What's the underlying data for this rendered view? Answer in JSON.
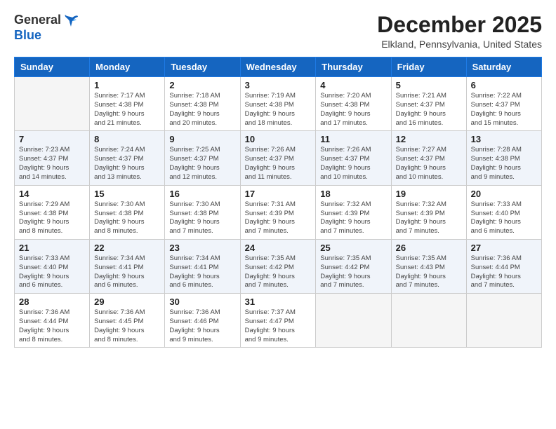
{
  "header": {
    "logo_general": "General",
    "logo_blue": "Blue",
    "month_title": "December 2025",
    "location": "Elkland, Pennsylvania, United States"
  },
  "days_of_week": [
    "Sunday",
    "Monday",
    "Tuesday",
    "Wednesday",
    "Thursday",
    "Friday",
    "Saturday"
  ],
  "weeks": [
    [
      {
        "day": "",
        "info": ""
      },
      {
        "day": "1",
        "info": "Sunrise: 7:17 AM\nSunset: 4:38 PM\nDaylight: 9 hours\nand 21 minutes."
      },
      {
        "day": "2",
        "info": "Sunrise: 7:18 AM\nSunset: 4:38 PM\nDaylight: 9 hours\nand 20 minutes."
      },
      {
        "day": "3",
        "info": "Sunrise: 7:19 AM\nSunset: 4:38 PM\nDaylight: 9 hours\nand 18 minutes."
      },
      {
        "day": "4",
        "info": "Sunrise: 7:20 AM\nSunset: 4:38 PM\nDaylight: 9 hours\nand 17 minutes."
      },
      {
        "day": "5",
        "info": "Sunrise: 7:21 AM\nSunset: 4:37 PM\nDaylight: 9 hours\nand 16 minutes."
      },
      {
        "day": "6",
        "info": "Sunrise: 7:22 AM\nSunset: 4:37 PM\nDaylight: 9 hours\nand 15 minutes."
      }
    ],
    [
      {
        "day": "7",
        "info": "Sunrise: 7:23 AM\nSunset: 4:37 PM\nDaylight: 9 hours\nand 14 minutes."
      },
      {
        "day": "8",
        "info": "Sunrise: 7:24 AM\nSunset: 4:37 PM\nDaylight: 9 hours\nand 13 minutes."
      },
      {
        "day": "9",
        "info": "Sunrise: 7:25 AM\nSunset: 4:37 PM\nDaylight: 9 hours\nand 12 minutes."
      },
      {
        "day": "10",
        "info": "Sunrise: 7:26 AM\nSunset: 4:37 PM\nDaylight: 9 hours\nand 11 minutes."
      },
      {
        "day": "11",
        "info": "Sunrise: 7:26 AM\nSunset: 4:37 PM\nDaylight: 9 hours\nand 10 minutes."
      },
      {
        "day": "12",
        "info": "Sunrise: 7:27 AM\nSunset: 4:37 PM\nDaylight: 9 hours\nand 10 minutes."
      },
      {
        "day": "13",
        "info": "Sunrise: 7:28 AM\nSunset: 4:38 PM\nDaylight: 9 hours\nand 9 minutes."
      }
    ],
    [
      {
        "day": "14",
        "info": "Sunrise: 7:29 AM\nSunset: 4:38 PM\nDaylight: 9 hours\nand 8 minutes."
      },
      {
        "day": "15",
        "info": "Sunrise: 7:30 AM\nSunset: 4:38 PM\nDaylight: 9 hours\nand 8 minutes."
      },
      {
        "day": "16",
        "info": "Sunrise: 7:30 AM\nSunset: 4:38 PM\nDaylight: 9 hours\nand 7 minutes."
      },
      {
        "day": "17",
        "info": "Sunrise: 7:31 AM\nSunset: 4:39 PM\nDaylight: 9 hours\nand 7 minutes."
      },
      {
        "day": "18",
        "info": "Sunrise: 7:32 AM\nSunset: 4:39 PM\nDaylight: 9 hours\nand 7 minutes."
      },
      {
        "day": "19",
        "info": "Sunrise: 7:32 AM\nSunset: 4:39 PM\nDaylight: 9 hours\nand 7 minutes."
      },
      {
        "day": "20",
        "info": "Sunrise: 7:33 AM\nSunset: 4:40 PM\nDaylight: 9 hours\nand 6 minutes."
      }
    ],
    [
      {
        "day": "21",
        "info": "Sunrise: 7:33 AM\nSunset: 4:40 PM\nDaylight: 9 hours\nand 6 minutes."
      },
      {
        "day": "22",
        "info": "Sunrise: 7:34 AM\nSunset: 4:41 PM\nDaylight: 9 hours\nand 6 minutes."
      },
      {
        "day": "23",
        "info": "Sunrise: 7:34 AM\nSunset: 4:41 PM\nDaylight: 9 hours\nand 6 minutes."
      },
      {
        "day": "24",
        "info": "Sunrise: 7:35 AM\nSunset: 4:42 PM\nDaylight: 9 hours\nand 7 minutes."
      },
      {
        "day": "25",
        "info": "Sunrise: 7:35 AM\nSunset: 4:42 PM\nDaylight: 9 hours\nand 7 minutes."
      },
      {
        "day": "26",
        "info": "Sunrise: 7:35 AM\nSunset: 4:43 PM\nDaylight: 9 hours\nand 7 minutes."
      },
      {
        "day": "27",
        "info": "Sunrise: 7:36 AM\nSunset: 4:44 PM\nDaylight: 9 hours\nand 7 minutes."
      }
    ],
    [
      {
        "day": "28",
        "info": "Sunrise: 7:36 AM\nSunset: 4:44 PM\nDaylight: 9 hours\nand 8 minutes."
      },
      {
        "day": "29",
        "info": "Sunrise: 7:36 AM\nSunset: 4:45 PM\nDaylight: 9 hours\nand 8 minutes."
      },
      {
        "day": "30",
        "info": "Sunrise: 7:36 AM\nSunset: 4:46 PM\nDaylight: 9 hours\nand 9 minutes."
      },
      {
        "day": "31",
        "info": "Sunrise: 7:37 AM\nSunset: 4:47 PM\nDaylight: 9 hours\nand 9 minutes."
      },
      {
        "day": "",
        "info": ""
      },
      {
        "day": "",
        "info": ""
      },
      {
        "day": "",
        "info": ""
      }
    ]
  ]
}
